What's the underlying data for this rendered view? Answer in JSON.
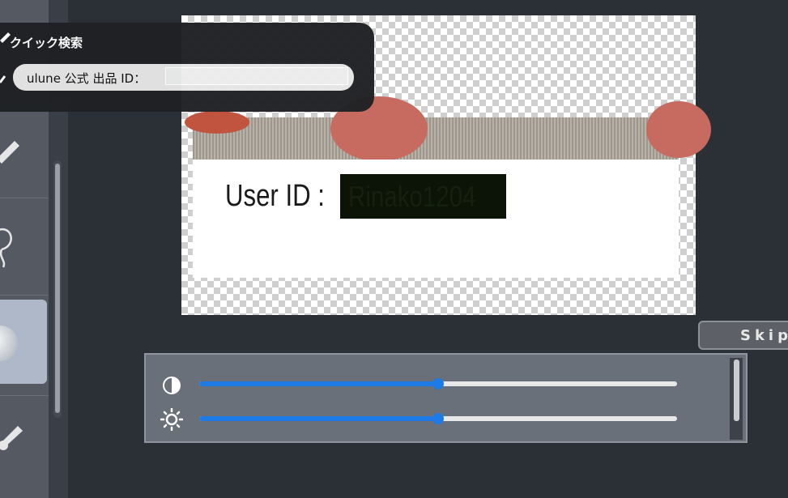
{
  "quick_search": {
    "title": "クイック検索",
    "field_prefix": "ulune 公式 出品 ID：",
    "value": "",
    "placeholder": ""
  },
  "canvas": {
    "id_label": "User ID :",
    "id_value": "Rinako1204"
  },
  "skip_label": "Skip",
  "sliders": {
    "contrast": {
      "icon": "contrast-icon",
      "value": 0.5
    },
    "brightness": {
      "icon": "brightness-icon",
      "value": 0.5
    }
  },
  "colors": {
    "accent": "#1e7be6",
    "panel": "#6a7079",
    "redaction": "#0c1407"
  }
}
